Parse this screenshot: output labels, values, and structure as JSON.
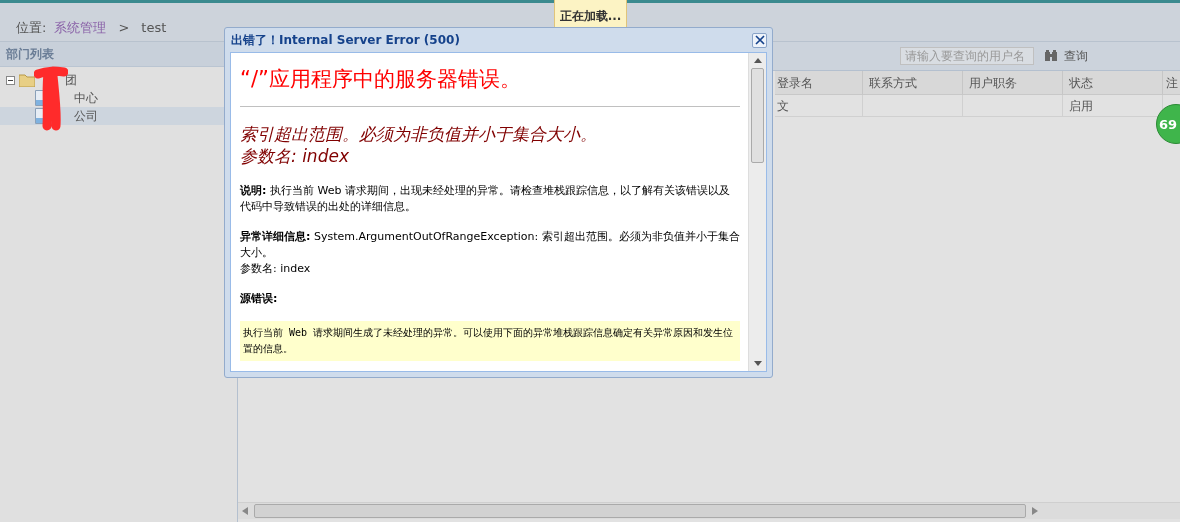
{
  "loading_tip": {
    "text": "正在加载..."
  },
  "breadcrumb": {
    "label": "位置:",
    "items": [
      {
        "text": "系统管理",
        "kind": "link"
      },
      {
        "text": ">",
        "kind": "sep"
      },
      {
        "text": "test",
        "kind": "current"
      }
    ]
  },
  "sidebar": {
    "title": "部门列表",
    "tree": [
      {
        "label": "团",
        "expanded": true,
        "selected": false,
        "children": [
          {
            "label": "中心",
            "selected": false
          },
          {
            "label": "公司",
            "selected": true
          }
        ]
      }
    ]
  },
  "toolbar": {
    "search": {
      "placeholder": "请输入要查询的用户名"
    },
    "button": "查询"
  },
  "table": {
    "columns": [
      "登录名",
      "联系方式",
      "用户职务",
      "状态",
      "注"
    ],
    "rows": [
      {
        "cells": [
          "文",
          null,
          null,
          "启用"
        ]
      }
    ]
  },
  "badge": {
    "text": "69"
  },
  "dialog": {
    "title": "出错了！Internal Server Error (500)",
    "heading": "“/”应用程序中的服务器错误。",
    "message": [
      "索引超出范围。必须为非负值并小于集合大小。",
      "参数名: index"
    ],
    "sections": [
      {
        "kind": "text",
        "lines": [
          "**说明:** 执行当前 Web 请求期间，出现未经处理的异常。请检查堆栈跟踪信息，以了解有关该错误以及代码中导致错误的出处的详细信息。"
        ]
      },
      {
        "kind": "text",
        "lines": [
          "**异常详细信息:** System.ArgumentOutOfRangeException: 索引超出范围。必须为非负值并小于集合大小。",
          "参数名: index"
        ]
      },
      {
        "kind": "heading",
        "lines": [
          "源错误:"
        ]
      },
      {
        "kind": "code",
        "lines": [
          "执行当前 Web 请求期间生成了未经处理的异常。可以使用下面的异常堆栈跟踪信息确定有关异常原因和发生位置的信息。"
        ]
      }
    ]
  }
}
